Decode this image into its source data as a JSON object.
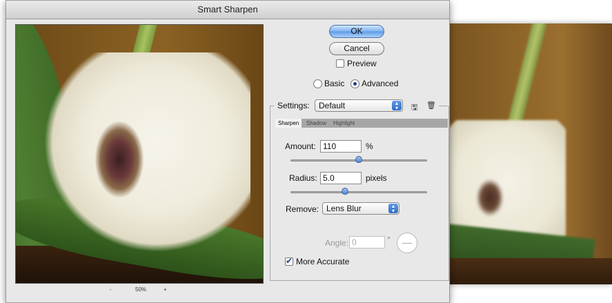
{
  "dialog": {
    "title": "Smart Sharpen",
    "zoom": {
      "minus": "-",
      "value": "50%",
      "plus": "+"
    },
    "buttons": {
      "ok": "OK",
      "cancel": "Cancel"
    },
    "preview_label": "Preview",
    "mode": {
      "basic": "Basic",
      "advanced": "Advanced",
      "selected": "Advanced"
    },
    "settings": {
      "label": "Settings:",
      "value": "Default"
    },
    "tabs": [
      {
        "label": "Sharpen",
        "active": true
      },
      {
        "label": "Shadow",
        "active": false
      },
      {
        "label": "Highlight",
        "active": false
      }
    ],
    "amount": {
      "label": "Amount:",
      "value": "110",
      "unit": "%",
      "slider_fraction": 0.5
    },
    "radius": {
      "label": "Radius:",
      "value": "5.0",
      "unit": "pixels",
      "slider_fraction": 0.4
    },
    "remove": {
      "label": "Remove:",
      "value": "Lens Blur"
    },
    "angle": {
      "label": "Angle:",
      "value": "0",
      "unit": "°"
    },
    "more_accurate": {
      "label": "More Accurate",
      "checked": true
    },
    "icons": {
      "save": "save-settings-icon",
      "delete": "trash-icon"
    }
  }
}
